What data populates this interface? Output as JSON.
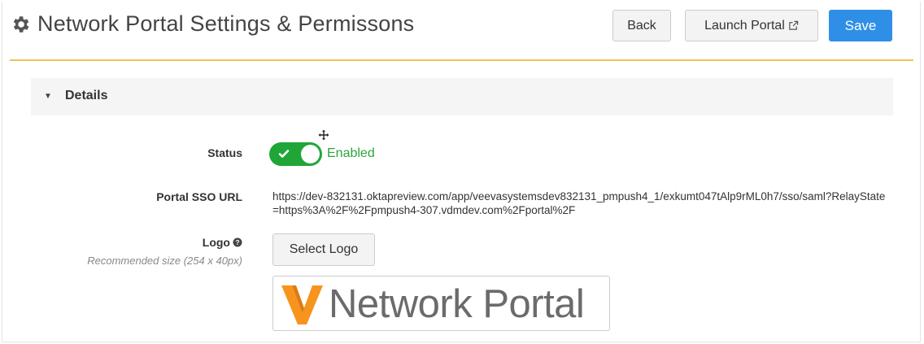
{
  "header": {
    "title": "Network Portal Settings & Permissons",
    "title_icon": "gear-icon",
    "back_label": "Back",
    "launch_label": "Launch Portal",
    "launch_icon": "external-link-icon",
    "save_label": "Save"
  },
  "colors": {
    "accent_rule": "#f0c258",
    "save_button": "#2f8fe6",
    "toggle_on": "#1fa636",
    "status_text": "#2aa53a",
    "logo_orange": "#f7941d"
  },
  "details": {
    "section_title": "Details",
    "status": {
      "label": "Status",
      "value": "Enabled",
      "enabled": true
    },
    "sso": {
      "label": "Portal SSO URL",
      "value": "https://dev-832131.oktapreview.com/app/veevasystemsdev832131_pmpush4_1/exkumt047tAlp9rML0h7/sso/saml?RelayState=https%3A%2F%2Fpmpush4-307.vdmdev.com%2Fportal%2F"
    },
    "logo": {
      "label": "Logo",
      "hint": "Recommended size (254 x 40px)",
      "button_label": "Select Logo",
      "preview_text": "Network Portal"
    }
  }
}
